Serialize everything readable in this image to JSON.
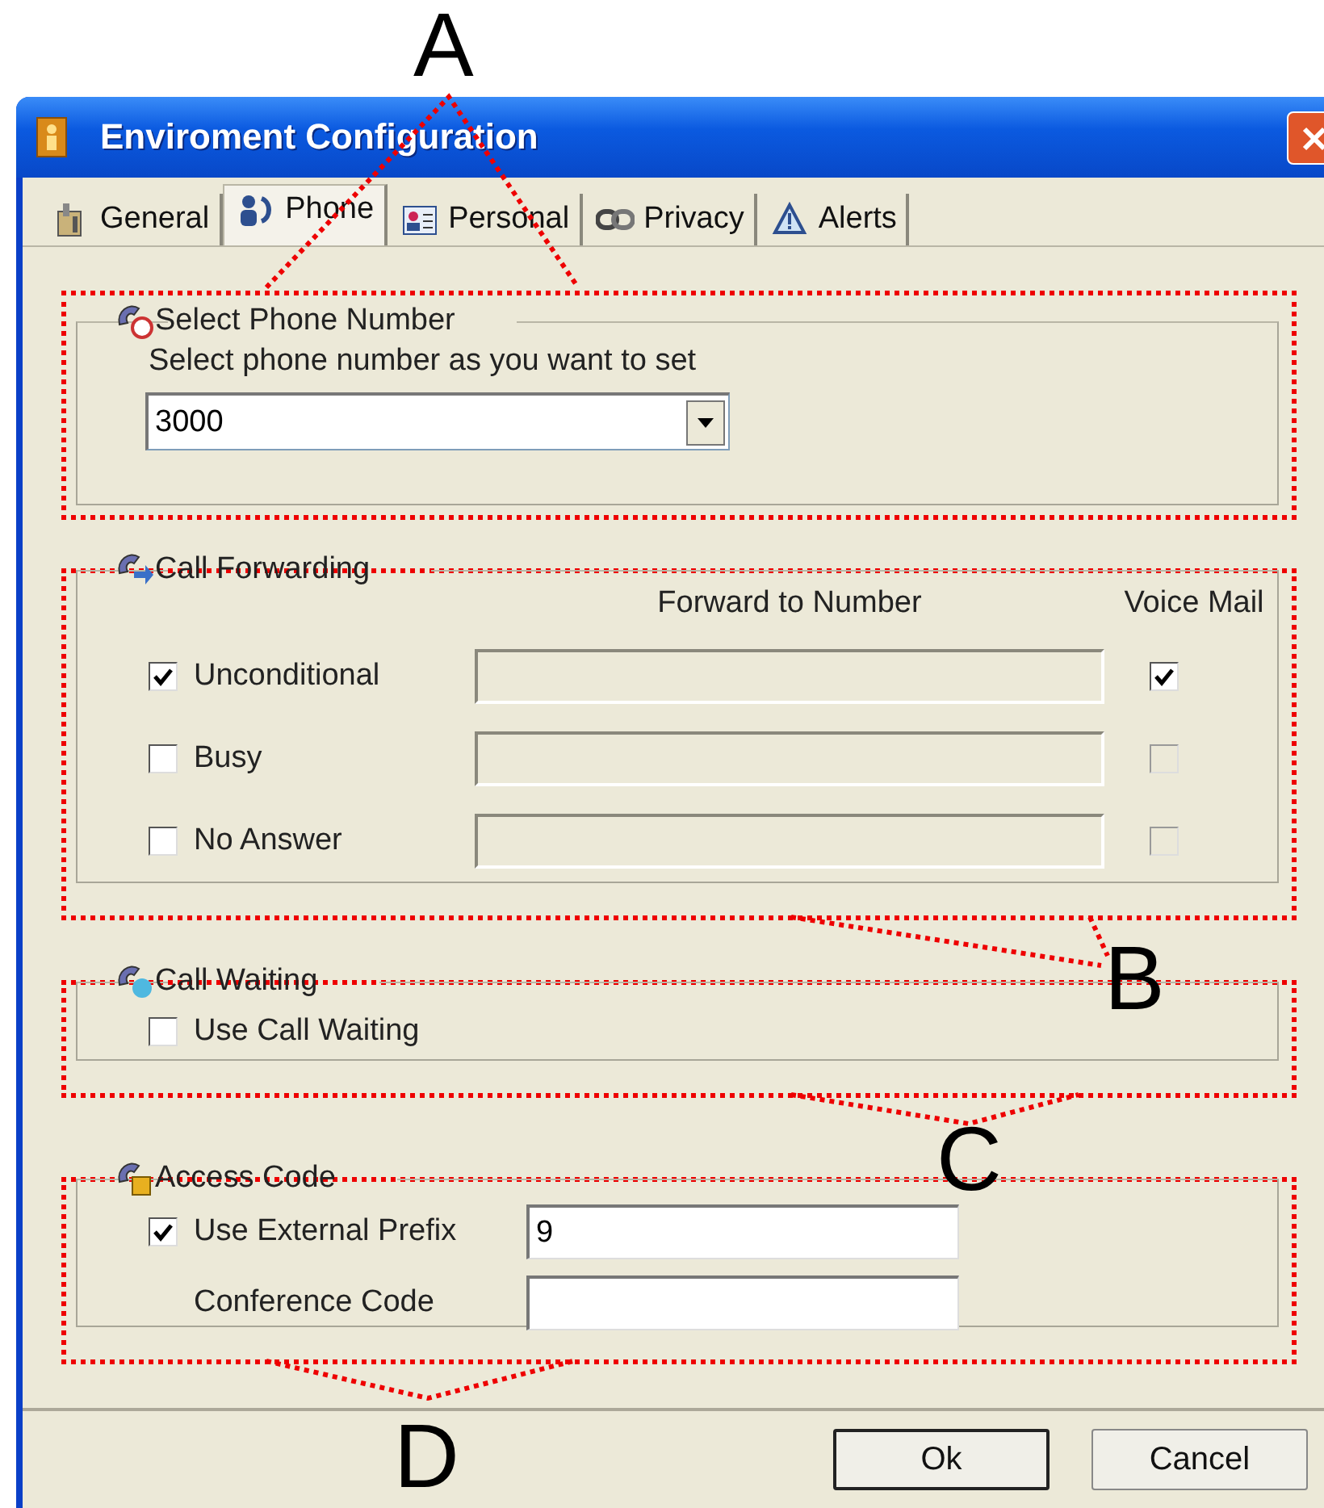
{
  "window": {
    "title": "Enviroment Configuration"
  },
  "tabs": [
    {
      "label": "General",
      "selected": false
    },
    {
      "label": "Phone",
      "selected": true
    },
    {
      "label": "Personal",
      "selected": false
    },
    {
      "label": "Privacy",
      "selected": false
    },
    {
      "label": "Alerts",
      "selected": false
    }
  ],
  "groups": [
    {
      "kind": "select",
      "title": "Select Phone Number",
      "label": "Select phone number as you want to set",
      "value": "3000"
    },
    {
      "kind": "forwarding",
      "title": "Call Forwarding",
      "columns": [
        "Forward to Number",
        "Voice Mail"
      ],
      "rows": [
        {
          "label": "Unconditional",
          "checked": true,
          "voice_mail": {
            "checked": true,
            "disabled": false
          }
        },
        {
          "label": "Busy",
          "checked": false,
          "voice_mail": {
            "checked": false,
            "disabled": true
          }
        },
        {
          "label": "No Answer",
          "checked": false,
          "voice_mail": {
            "checked": false,
            "disabled": true
          }
        }
      ]
    },
    {
      "kind": "waiting",
      "title": "Call Waiting",
      "options": [
        {
          "label": "Use Call Waiting",
          "checked": false
        }
      ]
    },
    {
      "kind": "access",
      "title": "Access Code",
      "fields": [
        {
          "label": "Use External Prefix",
          "checked": true,
          "value": "9"
        },
        {
          "label": "Conference Code"
        }
      ]
    }
  ],
  "buttons": [
    {
      "label": "Ok",
      "default": true
    },
    {
      "label": "Cancel",
      "default": false
    }
  ],
  "callouts": [
    {
      "label": "A"
    },
    {
      "label": "B"
    },
    {
      "label": "C"
    },
    {
      "label": "D"
    }
  ]
}
